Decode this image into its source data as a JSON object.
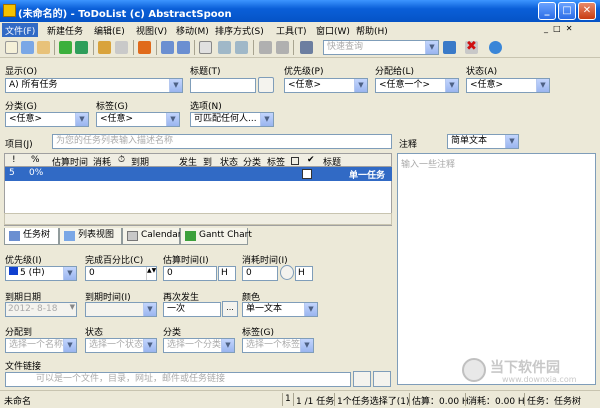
{
  "window": {
    "title": "(未命名的) - ToDoList (c) AbstractSpoon"
  },
  "menu": [
    "文件(F)",
    "新建任务",
    "编辑(E)",
    "视图(V)",
    "移动(M)",
    "排序方式(S)",
    "工具(T)",
    "窗口(W)",
    "帮助(H)"
  ],
  "toolbar": {
    "quick_search_placeholder": "快速查询"
  },
  "filters": {
    "show_label": "显示(O)",
    "show_value": "A) 所有任务",
    "title_label": "标题(T)",
    "priority_label": "优先级(P)",
    "priority_value": "<任意>",
    "allocto_label": "分配给(L)",
    "allocto_value": "<任意一个>",
    "status_label": "状态(A)",
    "status_value": "<任意>",
    "category_label": "分类(G)",
    "category_value": "<任意>",
    "tags_label": "标签(G)",
    "tags_value": "<任意>",
    "options_label": "选项(N)",
    "options_value": "可匹配任何人..."
  },
  "project": {
    "label": "项目(J)",
    "placeholder": "为您的任务列表输入描述名称"
  },
  "comments": {
    "label": "注释",
    "format": "简单文本",
    "placeholder": "输入一些注释"
  },
  "grid": {
    "columns": [
      "!",
      "%",
      "估算时间",
      "消耗",
      "⏱",
      "到期",
      "发生",
      "到",
      "状态",
      "分类",
      "标签",
      "",
      "✔",
      "标题"
    ],
    "row": {
      "priority": "5",
      "percent": "0%",
      "title": "单一任务"
    }
  },
  "tabs": [
    "任务树",
    "列表视图",
    "Calendar",
    "Gantt Chart"
  ],
  "details": {
    "priority_label": "优先级(I)",
    "priority_value": "5 (中)",
    "percent_label": "完成百分比(C)",
    "percent_value": "0",
    "est_label": "估算时间(I)",
    "est_value": "0",
    "est_unit": "H",
    "spent_label": "消耗时间(I)",
    "spent_value": "0",
    "spent_unit": "H",
    "due_date_label": "到期日期",
    "due_date_value": "2012- 8-18",
    "due_time_label": "到期时间(I)",
    "recur_label": "再次发生",
    "recur_value": "一次",
    "color_label": "颜色",
    "color_value": "单一文本",
    "allocto_label": "分配到",
    "allocto_placeholder": "选择一个名称",
    "status_label": "状态",
    "status_placeholder": "选择一个状态",
    "category_label": "分类",
    "category_placeholder": "选择一个分类",
    "tags_label": "标签(G)",
    "tags_placeholder": "选择一个标签",
    "filelink_label": "文件链接",
    "filelink_placeholder": "可以是一个文件，目录，网址，邮件或任务链接"
  },
  "statusbar": {
    "name": "未命名",
    "page": "1",
    "count": "1 /1 任务",
    "selected": "1个任务选择了(1)",
    "estimate": "估算：0.00 H",
    "spent": "消耗：0.00 H",
    "view": "任务：任务树"
  },
  "watermark": {
    "text": "当下软件园",
    "url": "www.downxia.com"
  }
}
